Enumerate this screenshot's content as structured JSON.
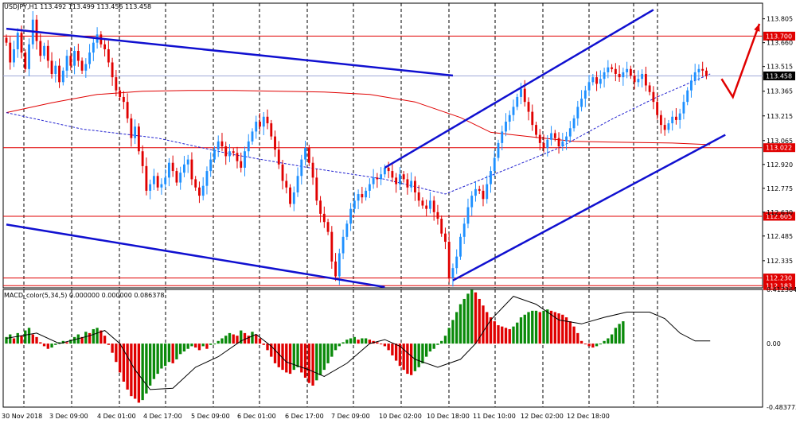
{
  "window_title": "USDJPY,H1 113.492 113.499 113.456 113.458",
  "indicator_title": "MACD_color(5,34,5) 0.000000 0.000000 0.086378",
  "colors": {
    "background": "#ffffff",
    "bull": "#1e90ff",
    "bear": "#e00000",
    "channel": "#1010d0",
    "level": "#e00000",
    "ma_red": "#e00000",
    "ma_blue_dash": "#2020d0",
    "macd_up": "#0a8a0a",
    "macd_down": "#e00000",
    "signal": "#000000",
    "current_price_line": "#a0a8d8"
  },
  "chart_data": [
    {
      "type": "candlestick",
      "symbol": "USDJPY",
      "timeframe": "H1",
      "ohlc_last": {
        "open": 113.492,
        "high": 113.499,
        "low": 113.456,
        "close": 113.458
      },
      "ylim": [
        112.17,
        113.9
      ],
      "y_ticks": [
        "113.805",
        "113.660",
        "113.515",
        "113.365",
        "113.215",
        "113.065",
        "112.920",
        "112.775",
        "112.630",
        "112.485",
        "112.335"
      ],
      "y_tick_values": [
        113.805,
        113.66,
        113.515,
        113.365,
        113.215,
        113.065,
        112.92,
        112.775,
        112.63,
        112.485,
        112.335
      ],
      "x_tick_labels": [
        "30 Nov 2018",
        "3 Dec 09:00",
        "4 Dec 01:00",
        "4 Dec 17:00",
        "5 Dec 09:00",
        "6 Dec 01:00",
        "6 Dec 17:00",
        "7 Dec 09:00",
        "10 Dec 02:00",
        "10 Dec 18:00",
        "11 Dec 10:00",
        "12 Dec 02:00",
        "12 Dec 18:00"
      ],
      "x_range_bars": [
        0,
        185
      ],
      "grid": "vertical dashed",
      "current_price": {
        "value": 113.458,
        "label": "113.458"
      },
      "price_levels": [
        {
          "value": 113.7,
          "label": "113.700"
        },
        {
          "value": 113.022,
          "label": "113.022"
        },
        {
          "value": 112.605,
          "label": "112.605"
        },
        {
          "value": 112.23,
          "label": "112.230"
        },
        {
          "value": 112.183,
          "label": "112.183"
        }
      ],
      "trend_lines": [
        {
          "name": "falling channel upper",
          "from": [
            0,
            113.745
          ],
          "to": [
            118,
            113.46
          ]
        },
        {
          "name": "falling channel lower",
          "from": [
            0,
            112.555
          ],
          "to": [
            100,
            112.175
          ]
        },
        {
          "name": "rising channel upper",
          "from": [
            100,
            112.9
          ],
          "to": [
            171,
            113.86
          ]
        },
        {
          "name": "rising channel lower",
          "from": [
            118,
            112.215
          ],
          "to": [
            190,
            113.1
          ]
        }
      ],
      "projection": [
        [
          189,
          113.44
        ],
        [
          192,
          113.33
        ],
        [
          199,
          113.775
        ]
      ],
      "moving_average_red": [
        [
          0,
          113.235
        ],
        [
          12,
          113.295
        ],
        [
          24,
          113.345
        ],
        [
          36,
          113.365
        ],
        [
          48,
          113.37
        ],
        [
          60,
          113.37
        ],
        [
          72,
          113.365
        ],
        [
          84,
          113.36
        ],
        [
          96,
          113.345
        ],
        [
          108,
          113.3
        ],
        [
          120,
          113.205
        ],
        [
          128,
          113.115
        ],
        [
          140,
          113.085
        ],
        [
          150,
          113.06
        ],
        [
          162,
          113.055
        ],
        [
          176,
          113.05
        ],
        [
          186,
          113.04
        ]
      ],
      "moving_average_blue_dashed": [
        [
          0,
          113.235
        ],
        [
          20,
          113.135
        ],
        [
          40,
          113.08
        ],
        [
          60,
          112.98
        ],
        [
          80,
          112.9
        ],
        [
          100,
          112.83
        ],
        [
          116,
          112.74
        ],
        [
          130,
          112.87
        ],
        [
          146,
          113.02
        ],
        [
          160,
          113.195
        ],
        [
          172,
          113.33
        ],
        [
          186,
          113.47
        ]
      ],
      "close_values": [
        113.66,
        113.54,
        113.62,
        113.72,
        113.6,
        113.5,
        113.65,
        113.8,
        113.67,
        113.58,
        113.64,
        113.55,
        113.47,
        113.52,
        113.42,
        113.49,
        113.58,
        113.52,
        113.61,
        113.55,
        113.49,
        113.53,
        113.6,
        113.66,
        113.71,
        113.65,
        113.62,
        113.54,
        113.45,
        113.37,
        113.33,
        113.3,
        113.2,
        113.08,
        113.15,
        113.0,
        112.91,
        112.76,
        112.8,
        112.85,
        112.78,
        112.8,
        112.84,
        112.93,
        112.88,
        112.81,
        112.87,
        112.92,
        112.95,
        112.83,
        112.78,
        112.73,
        112.79,
        112.88,
        112.95,
        113.01,
        113.06,
        113.03,
        112.97,
        113.0,
        112.99,
        112.94,
        112.9,
        113.0,
        113.06,
        113.12,
        113.18,
        113.15,
        113.21,
        113.17,
        113.09,
        113.01,
        112.92,
        112.82,
        112.78,
        112.68,
        112.75,
        112.85,
        112.95,
        113.02,
        112.93,
        112.84,
        112.7,
        112.62,
        112.57,
        112.51,
        112.33,
        112.24,
        112.38,
        112.48,
        112.56,
        112.65,
        112.7,
        112.74,
        112.72,
        112.76,
        112.8,
        112.84,
        112.83,
        112.86,
        112.9,
        112.88,
        112.84,
        112.8,
        112.86,
        112.83,
        112.78,
        112.82,
        112.75,
        112.7,
        112.67,
        112.65,
        112.7,
        112.63,
        112.59,
        112.5,
        112.45,
        112.23,
        112.29,
        112.36,
        112.48,
        112.56,
        112.66,
        112.73,
        112.77,
        112.76,
        112.71,
        112.8,
        112.88,
        112.96,
        113.05,
        113.12,
        113.18,
        113.22,
        113.27,
        113.33,
        113.38,
        113.3,
        113.24,
        113.16,
        113.1,
        113.05,
        113.02,
        113.07,
        113.11,
        113.08,
        113.03,
        113.06,
        113.09,
        113.14,
        113.2,
        113.27,
        113.32,
        113.37,
        113.42,
        113.45,
        113.41,
        113.44,
        113.48,
        113.51,
        113.5,
        113.47,
        113.45,
        113.48,
        113.5,
        113.46,
        113.42,
        113.44,
        113.47,
        113.4,
        113.36,
        113.3,
        113.22,
        113.16,
        113.13,
        113.17,
        113.21,
        113.19,
        113.23,
        113.3,
        113.37,
        113.43,
        113.48,
        113.5,
        113.49,
        113.458
      ]
    },
    {
      "type": "bar",
      "name": "MACD_color(5,34,5)",
      "ylim": [
        -0.483773,
        0.412364
      ],
      "y_ticks": [
        "0.412364",
        "0.00",
        "-0.483773"
      ],
      "y_tick_values": [
        0.412364,
        0.0,
        -0.483773
      ],
      "values": [
        0.05,
        0.07,
        0.04,
        0.08,
        0.06,
        0.1,
        0.12,
        0.07,
        0.05,
        0.01,
        -0.02,
        -0.04,
        -0.03,
        -0.01,
        0.01,
        0.02,
        0.01,
        0.03,
        0.05,
        0.07,
        0.05,
        0.09,
        0.08,
        0.11,
        0.12,
        0.1,
        0.06,
        -0.01,
        -0.07,
        -0.14,
        -0.22,
        -0.29,
        -0.35,
        -0.4,
        -0.42,
        -0.45,
        -0.43,
        -0.38,
        -0.32,
        -0.27,
        -0.23,
        -0.19,
        -0.17,
        -0.14,
        -0.15,
        -0.12,
        -0.08,
        -0.06,
        -0.04,
        -0.02,
        -0.03,
        -0.05,
        -0.02,
        -0.04,
        -0.01,
        0.0,
        0.02,
        0.04,
        0.06,
        0.08,
        0.07,
        0.06,
        0.1,
        0.08,
        0.06,
        0.09,
        0.07,
        0.04,
        -0.01,
        -0.05,
        -0.1,
        -0.15,
        -0.18,
        -0.2,
        -0.22,
        -0.23,
        -0.2,
        -0.18,
        -0.22,
        -0.26,
        -0.3,
        -0.32,
        -0.28,
        -0.24,
        -0.2,
        -0.15,
        -0.1,
        -0.05,
        -0.02,
        0.01,
        0.03,
        0.04,
        0.05,
        0.03,
        0.04,
        0.04,
        0.03,
        0.02,
        0.01,
        0.0,
        -0.02,
        -0.05,
        -0.09,
        -0.13,
        -0.17,
        -0.2,
        -0.23,
        -0.24,
        -0.21,
        -0.18,
        -0.15,
        -0.1,
        -0.06,
        -0.04,
        -0.01,
        0.02,
        0.06,
        0.12,
        0.18,
        0.24,
        0.3,
        0.34,
        0.38,
        0.41,
        0.39,
        0.34,
        0.29,
        0.24,
        0.2,
        0.17,
        0.14,
        0.13,
        0.12,
        0.11,
        0.13,
        0.16,
        0.2,
        0.22,
        0.24,
        0.25,
        0.25,
        0.24,
        0.25,
        0.26,
        0.25,
        0.24,
        0.23,
        0.22,
        0.2,
        0.17,
        0.13,
        0.08,
        0.02,
        0.0,
        -0.02,
        -0.03,
        -0.02,
        0.0,
        0.02,
        0.04,
        0.07,
        0.12,
        0.15,
        0.17
      ],
      "signal_line": [
        [
          0,
          0.04
        ],
        [
          8,
          0.08
        ],
        [
          14,
          0.0
        ],
        [
          22,
          0.06
        ],
        [
          26,
          0.1
        ],
        [
          30,
          0.0
        ],
        [
          34,
          -0.2
        ],
        [
          38,
          -0.35
        ],
        [
          44,
          -0.34
        ],
        [
          50,
          -0.18
        ],
        [
          56,
          -0.1
        ],
        [
          62,
          0.02
        ],
        [
          66,
          0.07
        ],
        [
          70,
          -0.02
        ],
        [
          74,
          -0.14
        ],
        [
          80,
          -0.2
        ],
        [
          84,
          -0.25
        ],
        [
          90,
          -0.15
        ],
        [
          96,
          0.0
        ],
        [
          100,
          0.03
        ],
        [
          104,
          -0.02
        ],
        [
          108,
          -0.12
        ],
        [
          114,
          -0.18
        ],
        [
          120,
          -0.12
        ],
        [
          124,
          0.0
        ],
        [
          128,
          0.18
        ],
        [
          134,
          0.36
        ],
        [
          140,
          0.3
        ],
        [
          146,
          0.18
        ],
        [
          152,
          0.15
        ],
        [
          158,
          0.2
        ],
        [
          164,
          0.24
        ],
        [
          170,
          0.24
        ],
        [
          174,
          0.19
        ],
        [
          178,
          0.08
        ],
        [
          182,
          0.02
        ],
        [
          186,
          0.02
        ]
      ]
    }
  ]
}
